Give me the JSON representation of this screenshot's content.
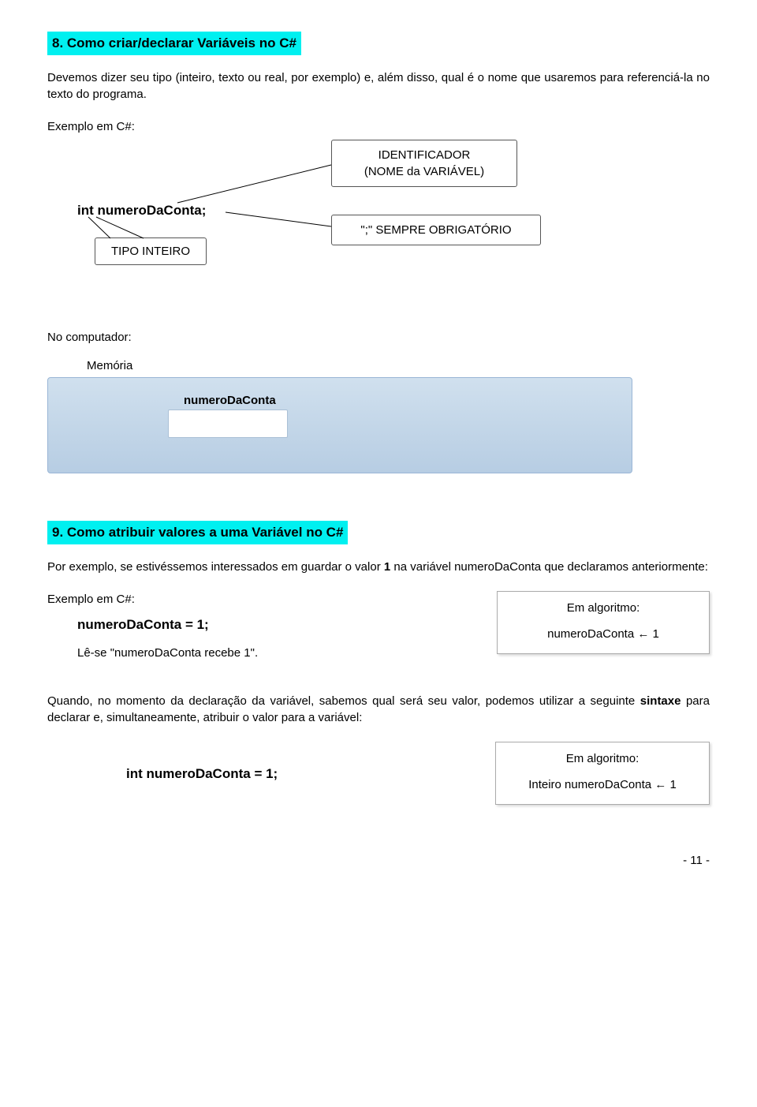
{
  "section8": {
    "heading": "8. Como criar/declarar Variáveis no C#",
    "para": "Devemos dizer seu tipo (inteiro, texto ou real, por exemplo) e, além disso, qual é o nome que usaremos para referenciá-la no texto do programa.",
    "example_label": "Exemplo em C#:",
    "code": "int  numeroDaConta;",
    "callout_identifier_line1": "IDENTIFICADOR",
    "callout_identifier_line2": "(NOME da VARIÁVEL)",
    "callout_semicolon": "\";\" SEMPRE OBRIGATÓRIO",
    "tipo_inteiro": "TIPO INTEIRO",
    "no_computador": "No computador:",
    "memoria_label": "Memória",
    "var_label": "numeroDaConta"
  },
  "section9": {
    "heading": "9. Como atribuir valores a uma Variável no C#",
    "para_pre": "Por exemplo, se estivéssemos interessados em guardar o valor ",
    "para_bold": "1",
    "para_post": " na variável numeroDaConta que declaramos anteriormente:",
    "example_label": "Exemplo em C#:",
    "code": "numeroDaConta = 1;",
    "read_as": "Lê-se \"numeroDaConta recebe 1\".",
    "algo_title": "Em algoritmo:",
    "algo_body": "numeroDaConta ← 1",
    "para2_pre": "Quando, no momento da declaração da variável, sabemos qual será seu valor, podemos utilizar a seguinte ",
    "para2_bold": "sintaxe",
    "para2_post": " para declarar e, simultaneamente, atribuir o valor para a variável:",
    "code2": "int  numeroDaConta = 1;",
    "algo2_title": "Em algoritmo:",
    "algo2_body": "Inteiro  numeroDaConta ← 1"
  },
  "page_number": "- 11 -"
}
